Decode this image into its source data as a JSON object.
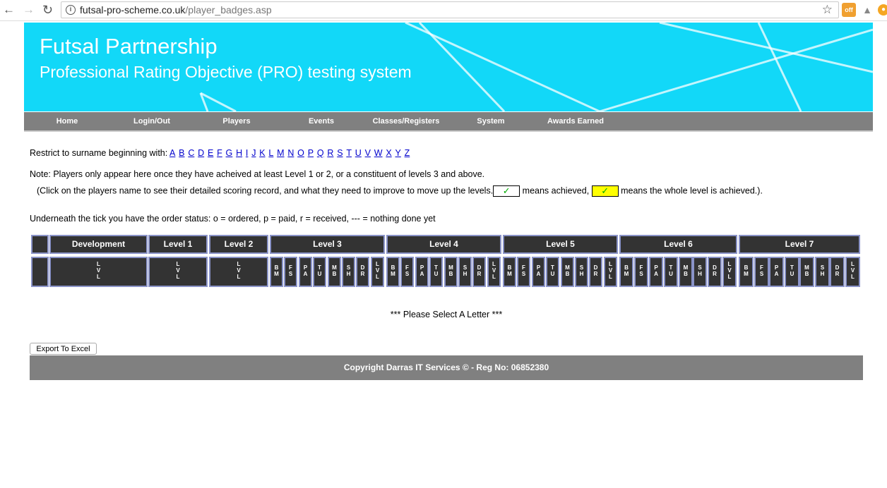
{
  "browser": {
    "url_domain": "futsal-pro-scheme.co.uk",
    "url_path": "/player_badges.asp",
    "ext_badge": "off"
  },
  "banner": {
    "title": "Futsal Partnership",
    "subtitle": "Professional Rating Objective (PRO) testing system"
  },
  "menu": [
    "Home",
    "Login/Out",
    "Players",
    "Events",
    "Classes/Registers",
    "System",
    "Awards Earned"
  ],
  "filter": {
    "label": "Restrict to surname beginning with:",
    "letters": [
      "A",
      "B",
      "C",
      "D",
      "E",
      "F",
      "G",
      "H",
      "I",
      "J",
      "K",
      "L",
      "M",
      "N",
      "O",
      "P",
      "Q",
      "R",
      "S",
      "T",
      "U",
      "V",
      "W",
      "X",
      "Y",
      "Z"
    ]
  },
  "notes": {
    "note1": "Note: Players only appear here once they have acheived at least Level 1 or 2, or a constituent of levels 3 and above.",
    "note2_pre": "(Click on the players name to see their detailed scoring record, and what they need to improve to move up the levels.",
    "note2_mid": " means achieved, ",
    "note2_post": " means the whole level is achieved.).",
    "tick": "✓",
    "status": "Underneath the tick you have the order status: o = ordered, p = paid, r = received, --- = nothing done yet"
  },
  "table": {
    "headers": [
      "Development",
      "Level 1",
      "Level 2",
      "Level 3",
      "Level 4",
      "Level 5",
      "Level 6",
      "Level 7"
    ],
    "single_sub": [
      "L",
      "V",
      "L"
    ],
    "multi_sub": [
      [
        "B",
        "M"
      ],
      [
        "F",
        "S"
      ],
      [
        "P",
        "A"
      ],
      [
        "T",
        "U"
      ],
      [
        "M",
        "B"
      ],
      [
        "S",
        "H"
      ],
      [
        "D",
        "R"
      ],
      [
        "L",
        "V",
        "L"
      ]
    ]
  },
  "select_message": "*** Please Select A Letter ***",
  "export_label": "Export To Excel",
  "footer": "Copyright Darras IT Services © - Reg No: 06852380",
  "colors": {
    "banner": "#12d8f8",
    "menu": "#808080",
    "cell": "#333333",
    "cell_border": "#8a93c8"
  }
}
